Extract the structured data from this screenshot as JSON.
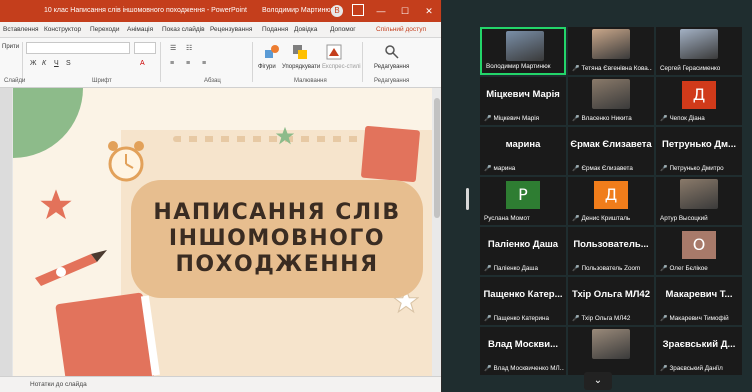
{
  "window": {
    "title": "10 клас Написання слів іншомовного походження - PowerPoint",
    "user": "Володимир Мартинюк",
    "avatar_letter": "В",
    "minimize": "—",
    "maximize": "☐",
    "close": "✕"
  },
  "tabs": [
    "Вставлення",
    "Конструктор",
    "Переходи",
    "Анімація",
    "Показ слайдів",
    "Рецензування",
    "Подання",
    "Довідка",
    "Допомог",
    "Спільний доступ"
  ],
  "ribbon": {
    "groups": [
      "Слайди",
      "Шрифт",
      "Абзац",
      "Малювання",
      "Редагування"
    ],
    "buttons": {
      "shapes": "Фігури",
      "arrange": "Упорядкувати",
      "quick_styles": "Експрес-стилі",
      "editing": "Редагування"
    },
    "left_label": "Прити"
  },
  "slide": {
    "title_lines": [
      "НАПИСАННЯ СЛІВ",
      "ІНШОМОВНОГО",
      "ПОХОДЖЕННЯ"
    ]
  },
  "notes": {
    "label": "Нотатки до слайда"
  },
  "participants": [
    {
      "name": "Володимир Мартинюк",
      "type": "photo",
      "active": true,
      "muted": false
    },
    {
      "name": "Тетяна Євгенівна Кова...",
      "type": "photo",
      "muted": true
    },
    {
      "name": "Сергей Герасименко",
      "type": "photo",
      "muted": false
    },
    {
      "name": "Міцкевич Марія",
      "type": "name",
      "display": "Міцкевич Марія",
      "muted": true
    },
    {
      "name": "Власенко Никита",
      "type": "photo",
      "muted": true
    },
    {
      "name": "Чепок Діана",
      "type": "letter",
      "letter": "Д",
      "color": "#d03a1a",
      "muted": true
    },
    {
      "name": "марина",
      "type": "name",
      "display": "марина",
      "muted": true
    },
    {
      "name": "Єрмак Єлизавета",
      "type": "name",
      "display": "Єрмак Єлизавета",
      "muted": true
    },
    {
      "name": "Петрунько Дмитро",
      "type": "name",
      "display": "Петрунько Дм...",
      "muted": true
    },
    {
      "name": "Руслана Момот",
      "type": "letter",
      "letter": "Р",
      "color": "#2e7d32",
      "muted": false
    },
    {
      "name": "Денис Кришталь",
      "type": "letter",
      "letter": "Д",
      "color": "#f07d1b",
      "muted": true
    },
    {
      "name": "Артур Высоцкий",
      "type": "photo",
      "muted": false
    },
    {
      "name": "Паліенко Даша",
      "type": "name",
      "display": "Паліенко Даша",
      "muted": true
    },
    {
      "name": "Пользователь Zoom",
      "type": "name",
      "display": "Пользователь...",
      "muted": true
    },
    {
      "name": "Олег Бєлікое",
      "type": "letter",
      "letter": "О",
      "color": "#a87a6a",
      "muted": true
    },
    {
      "name": "Пащенко Катерина",
      "type": "name",
      "display": "Пащенко Катер...",
      "muted": true
    },
    {
      "name": "Тхір Ольга МЛ42",
      "type": "name",
      "display": "Тхір Ольга МЛ42",
      "muted": true
    },
    {
      "name": "Макаревич Тимофій",
      "type": "name",
      "display": "Макаревич Т...",
      "muted": true
    },
    {
      "name": "Влад Москвиченко МЛ...",
      "type": "name",
      "display": "Влад Москви...",
      "muted": true
    },
    {
      "name": "",
      "type": "photo",
      "muted": false
    },
    {
      "name": "Зраєвський Даніїл",
      "type": "name",
      "display": "Зраєвський Д...",
      "muted": true
    }
  ],
  "gallery": {
    "chevron": "⌄"
  }
}
